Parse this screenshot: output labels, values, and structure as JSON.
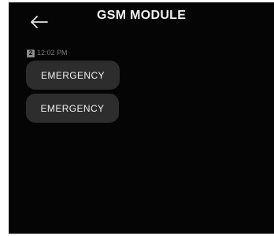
{
  "header": {
    "back_icon": "arrow-left-icon",
    "title": "GSM MODULE"
  },
  "conversation": {
    "sim_slot": "2",
    "timestamp": "12:02 PM",
    "messages": [
      {
        "text": "EMERGENCY"
      },
      {
        "text": "EMERGENCY"
      }
    ]
  },
  "colors": {
    "background": "#050505",
    "bubble": "#2d2d2d",
    "text": "#f0f0f0",
    "meta_text": "#7a7a7a"
  }
}
